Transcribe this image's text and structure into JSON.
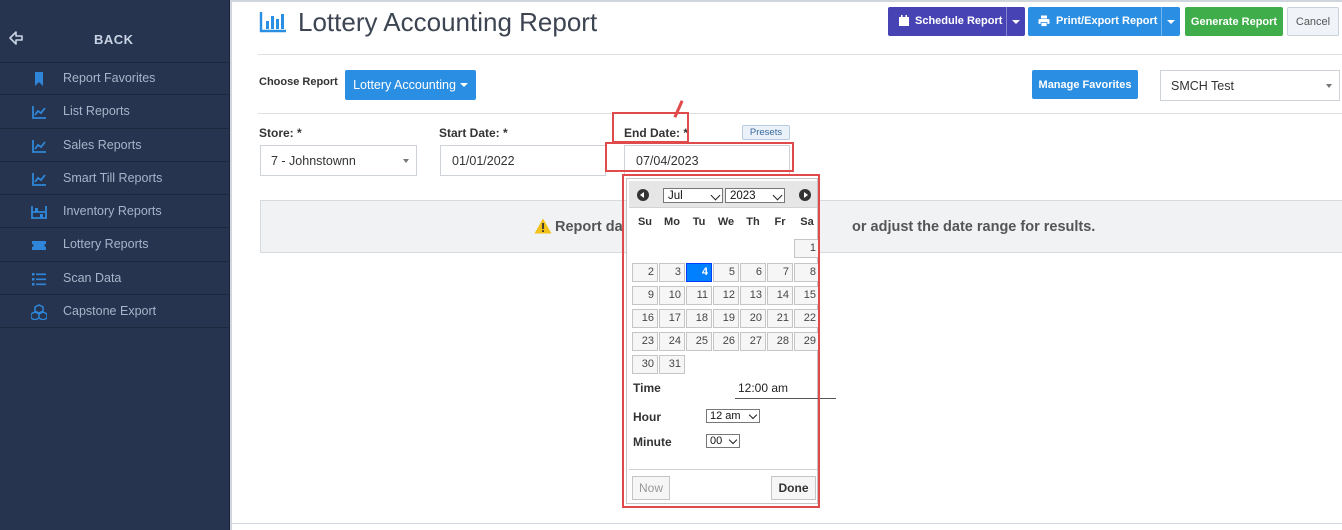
{
  "sidebar": {
    "back_label": "BACK",
    "items": [
      {
        "label": "Report Favorites",
        "icon": "bookmark-icon"
      },
      {
        "label": "List Reports",
        "icon": "chart-line-icon"
      },
      {
        "label": "Sales Reports",
        "icon": "chart-line-icon"
      },
      {
        "label": "Smart Till Reports",
        "icon": "chart-line-icon"
      },
      {
        "label": "Inventory Reports",
        "icon": "inventory-icon"
      },
      {
        "label": "Lottery Reports",
        "icon": "ticket-icon"
      },
      {
        "label": "Scan Data",
        "icon": "list-icon"
      },
      {
        "label": "Capstone Export",
        "icon": "cubes-icon"
      }
    ]
  },
  "header": {
    "title": "Lottery Accounting Report",
    "schedule_label": "Schedule Report",
    "print_label": "Print/Export Report",
    "generate_label": "Generate Report",
    "cancel_label": "Cancel"
  },
  "report": {
    "choose_label": "Choose Report",
    "choose_value": "Lottery Accounting",
    "manage_favorites_label": "Manage Favorites",
    "favorite_value": "SMCH Test"
  },
  "filters": {
    "store_label": "Store: *",
    "store_value": "7 - Johnstownn",
    "start_label": "Start Date: *",
    "start_value": "01/01/2022",
    "end_label": "End Date: *",
    "end_value": "07/04/2023",
    "presets_label": "Presets"
  },
  "alert": {
    "text_left": "Report da",
    "text_right": "or adjust the date range for results."
  },
  "calendar": {
    "month": "Jul",
    "year": "2023",
    "weekdays": [
      "Su",
      "Mo",
      "Tu",
      "We",
      "Th",
      "Fr",
      "Sa"
    ],
    "days": [
      "1",
      "2",
      "3",
      "4",
      "5",
      "6",
      "7",
      "8",
      "9",
      "10",
      "11",
      "12",
      "13",
      "14",
      "15",
      "16",
      "17",
      "18",
      "19",
      "20",
      "21",
      "22",
      "23",
      "24",
      "25",
      "26",
      "27",
      "28",
      "29",
      "30",
      "31"
    ],
    "selected_day": "4",
    "time_label": "Time",
    "time_value": "12:00 am",
    "hour_label": "Hour",
    "hour_value": "12 am",
    "minute_label": "Minute",
    "minute_value": "00",
    "now_label": "Now",
    "done_label": "Done"
  },
  "colors": {
    "sidebar_bg": "#26344f",
    "primary_blue": "#2a8ee3",
    "schedule_purple": "#4743b5",
    "generate_green": "#3fae4a",
    "highlight_red": "#e04a4a",
    "selected_day": "#007fff"
  }
}
